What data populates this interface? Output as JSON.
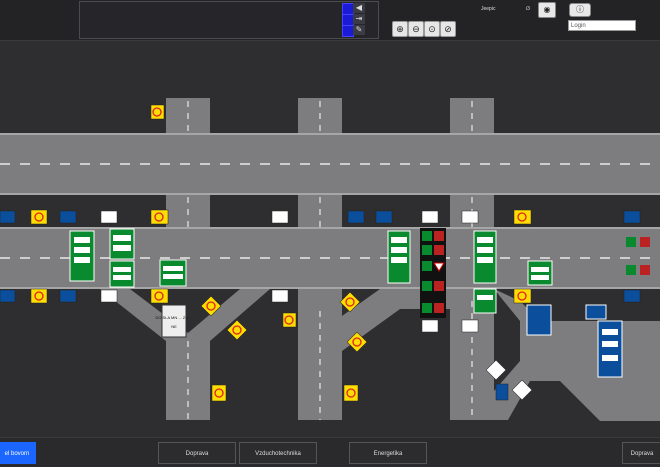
{
  "header": {
    "camera_label": "Jeepic",
    "camera_status": "i3",
    "login_placeholder": "Login"
  },
  "zoom_buttons": [
    "zoom-in-icon",
    "zoom-out-icon",
    "zoom-fit-icon",
    "zoom-reset-icon"
  ],
  "bottom_tabs": [
    {
      "label": "el bovorn",
      "active": true
    },
    {
      "label": "Doprava",
      "active": false
    },
    {
      "label": "Vzduchotechnika",
      "active": false
    },
    {
      "label": "Energetika",
      "active": false
    },
    {
      "label": "Doprava",
      "active": false
    }
  ],
  "signs": {
    "vms_text_1": "DO SLA MN ... ZU ...",
    "vms_text_2": "NE",
    "lane_signal_labels": [
      "↓",
      "↓",
      "✕"
    ]
  },
  "colors": {
    "background": "#2e2e30",
    "road": "#7d7d7f",
    "accent": "#1a66ff",
    "sign_yellow": "#ffdd00",
    "sign_blue": "#0b4f9c",
    "sign_green": "#0a8a2e"
  }
}
